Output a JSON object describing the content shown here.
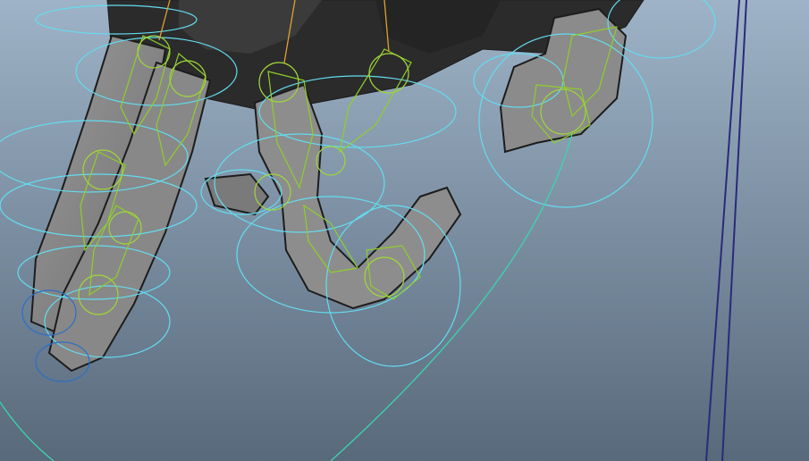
{
  "viewport": {
    "view": "perspective",
    "background_top": "#9eb3c7",
    "background_bottom": "#58697b"
  },
  "scene": {
    "mesh_color": "#8a8a8a",
    "mesh_dark": "#1c1c1c",
    "joint_color": "#8fcf2a",
    "joint_selected": "#e0a030",
    "control_color": "#64dcf0",
    "control_blue": "#2a6fc8",
    "curve_color": "#3ad6b2",
    "line_color": "#2a2a7a"
  }
}
